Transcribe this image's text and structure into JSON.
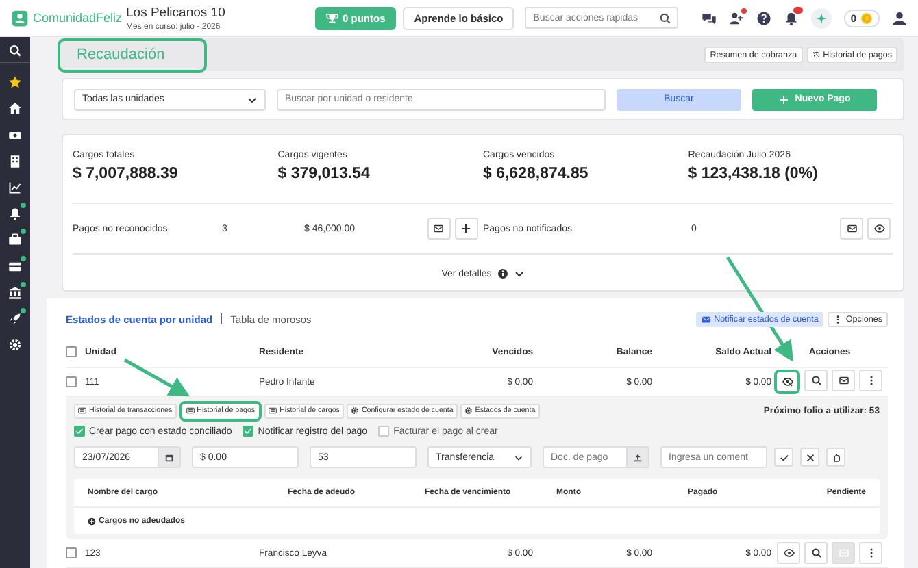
{
  "brand": {
    "name": "ComunidadFeliz"
  },
  "community": {
    "name": "Los Pelicanos 10",
    "period": "Mes en curso: julio - 2026"
  },
  "header_buttons": [
    {
      "kind": "points",
      "label": "0 puntos"
    },
    {
      "kind": "plain",
      "label": "Aprende lo básico"
    }
  ],
  "quick_search": {
    "placeholder": "Buscar acciones rápidas"
  },
  "top_icons": [
    {
      "kind": "chat",
      "badge": false
    },
    {
      "kind": "people",
      "badge": true
    },
    {
      "kind": "help",
      "badge": false
    },
    {
      "kind": "bell",
      "badge": true
    },
    {
      "kind": "sparkle",
      "badge": false
    }
  ],
  "coins": "0",
  "sidebar": {
    "items": [
      {
        "kind": "search",
        "badge": false
      },
      {
        "kind": "star",
        "badge": false
      },
      {
        "kind": "home",
        "badge": false
      },
      {
        "kind": "money",
        "badge": false
      },
      {
        "kind": "building",
        "badge": false
      },
      {
        "kind": "chart",
        "badge": false
      },
      {
        "kind": "bell",
        "badge": true
      },
      {
        "kind": "briefcase",
        "badge": true
      },
      {
        "kind": "card",
        "badge": true
      },
      {
        "kind": "bank",
        "badge": true
      },
      {
        "kind": "rocket",
        "badge": true
      },
      {
        "kind": "gear",
        "badge": false
      }
    ]
  },
  "page": {
    "title": "Recaudación",
    "highlighted": true,
    "actions": [
      {
        "kind": "plain",
        "label": "Resumen de cobranza"
      },
      {
        "kind": "history",
        "label": "Historial de pagos"
      }
    ]
  },
  "filters": {
    "unit_select": "Todas las unidades",
    "search_placeholder": "Buscar por unidad o residente",
    "search_button": "Buscar",
    "new_button": "Nuevo Pago"
  },
  "stats": [
    {
      "label": "Cargos totales",
      "value": "$ 7,007,888.39"
    },
    {
      "label": "Cargos vigentes",
      "value": "$ 379,013.54"
    },
    {
      "label": "Cargos vencidos",
      "value": "$ 6,628,874.85"
    },
    {
      "label": "Recaudación Julio 2026",
      "value": "$ 123,438.18 (0%)"
    }
  ],
  "pending": [
    {
      "label": "Pagos no reconocidos",
      "count": "3",
      "amount": "$ 46,000.00",
      "actions": [
        {
          "kind": "mail"
        },
        {
          "kind": "plus"
        }
      ]
    },
    {
      "label": "Pagos no notificados",
      "count": "0",
      "actions": [
        {
          "kind": "mail"
        },
        {
          "kind": "eye"
        }
      ]
    }
  ],
  "details": "Ver detalles",
  "views": [
    {
      "label": "Estados de cuenta por unidad",
      "selected": true
    },
    {
      "label": "Tabla de morosos",
      "selected": false
    }
  ],
  "table_actions": [
    {
      "kind": "notify",
      "label": "Notificar estados de cuenta"
    },
    {
      "kind": "options",
      "label": "Opciones"
    }
  ],
  "table": {
    "select_all_checked": false,
    "columns": [
      "Unidad",
      "Residente",
      "Vencidos",
      "Balance",
      "Saldo Actual",
      "Acciones"
    ],
    "rows": [
      {
        "unit": "111",
        "resident": "Pedro Infante",
        "overdue": "$ 0.00",
        "balance": "$ 0.00",
        "current": "$ 0.00",
        "checked": false,
        "expanded": true,
        "hidden": true,
        "highlighted": true,
        "mail_disabled": false
      },
      {
        "unit": "123",
        "resident": "Francisco Leyva",
        "overdue": "$ 0.00",
        "balance": "$ 0.00",
        "current": "$ 0.00",
        "checked": false,
        "expanded": false,
        "hidden": false,
        "highlighted": false,
        "mail_disabled": true
      }
    ]
  },
  "payment_panel": {
    "tabs": [
      {
        "kind": "list",
        "label": "Historial de transacciones",
        "highlighted": false
      },
      {
        "kind": "list",
        "label": "Historial de pagos",
        "highlighted": true
      },
      {
        "kind": "list",
        "label": "Historial de cargos",
        "highlighted": false
      },
      {
        "kind": "gear",
        "label": "Configurar estado de cuenta",
        "highlighted": false
      },
      {
        "kind": "gear",
        "label": "Estados de cuenta",
        "highlighted": false
      }
    ],
    "next_folio": "Próximo folio a utilizar: 53",
    "options": [
      {
        "label": "Crear pago con estado conciliado",
        "checked": true
      },
      {
        "label": "Notificar registro del pago",
        "checked": true
      },
      {
        "label": "Facturar el pago al crear",
        "checked": false
      }
    ],
    "form": {
      "date": "23/07/2026",
      "amount": "$ 0.00",
      "folio": "53",
      "method": "Transferencia",
      "doc_placeholder": "Doc. de pago",
      "comment_placeholder": "Ingresa un coment"
    },
    "charges": {
      "columns": [
        "Nombre del cargo",
        "Fecha de adeudo",
        "Fecha de vencimiento",
        "Monto",
        "Pagado",
        "Pendiente"
      ],
      "group": "Cargos no adeudados"
    }
  }
}
